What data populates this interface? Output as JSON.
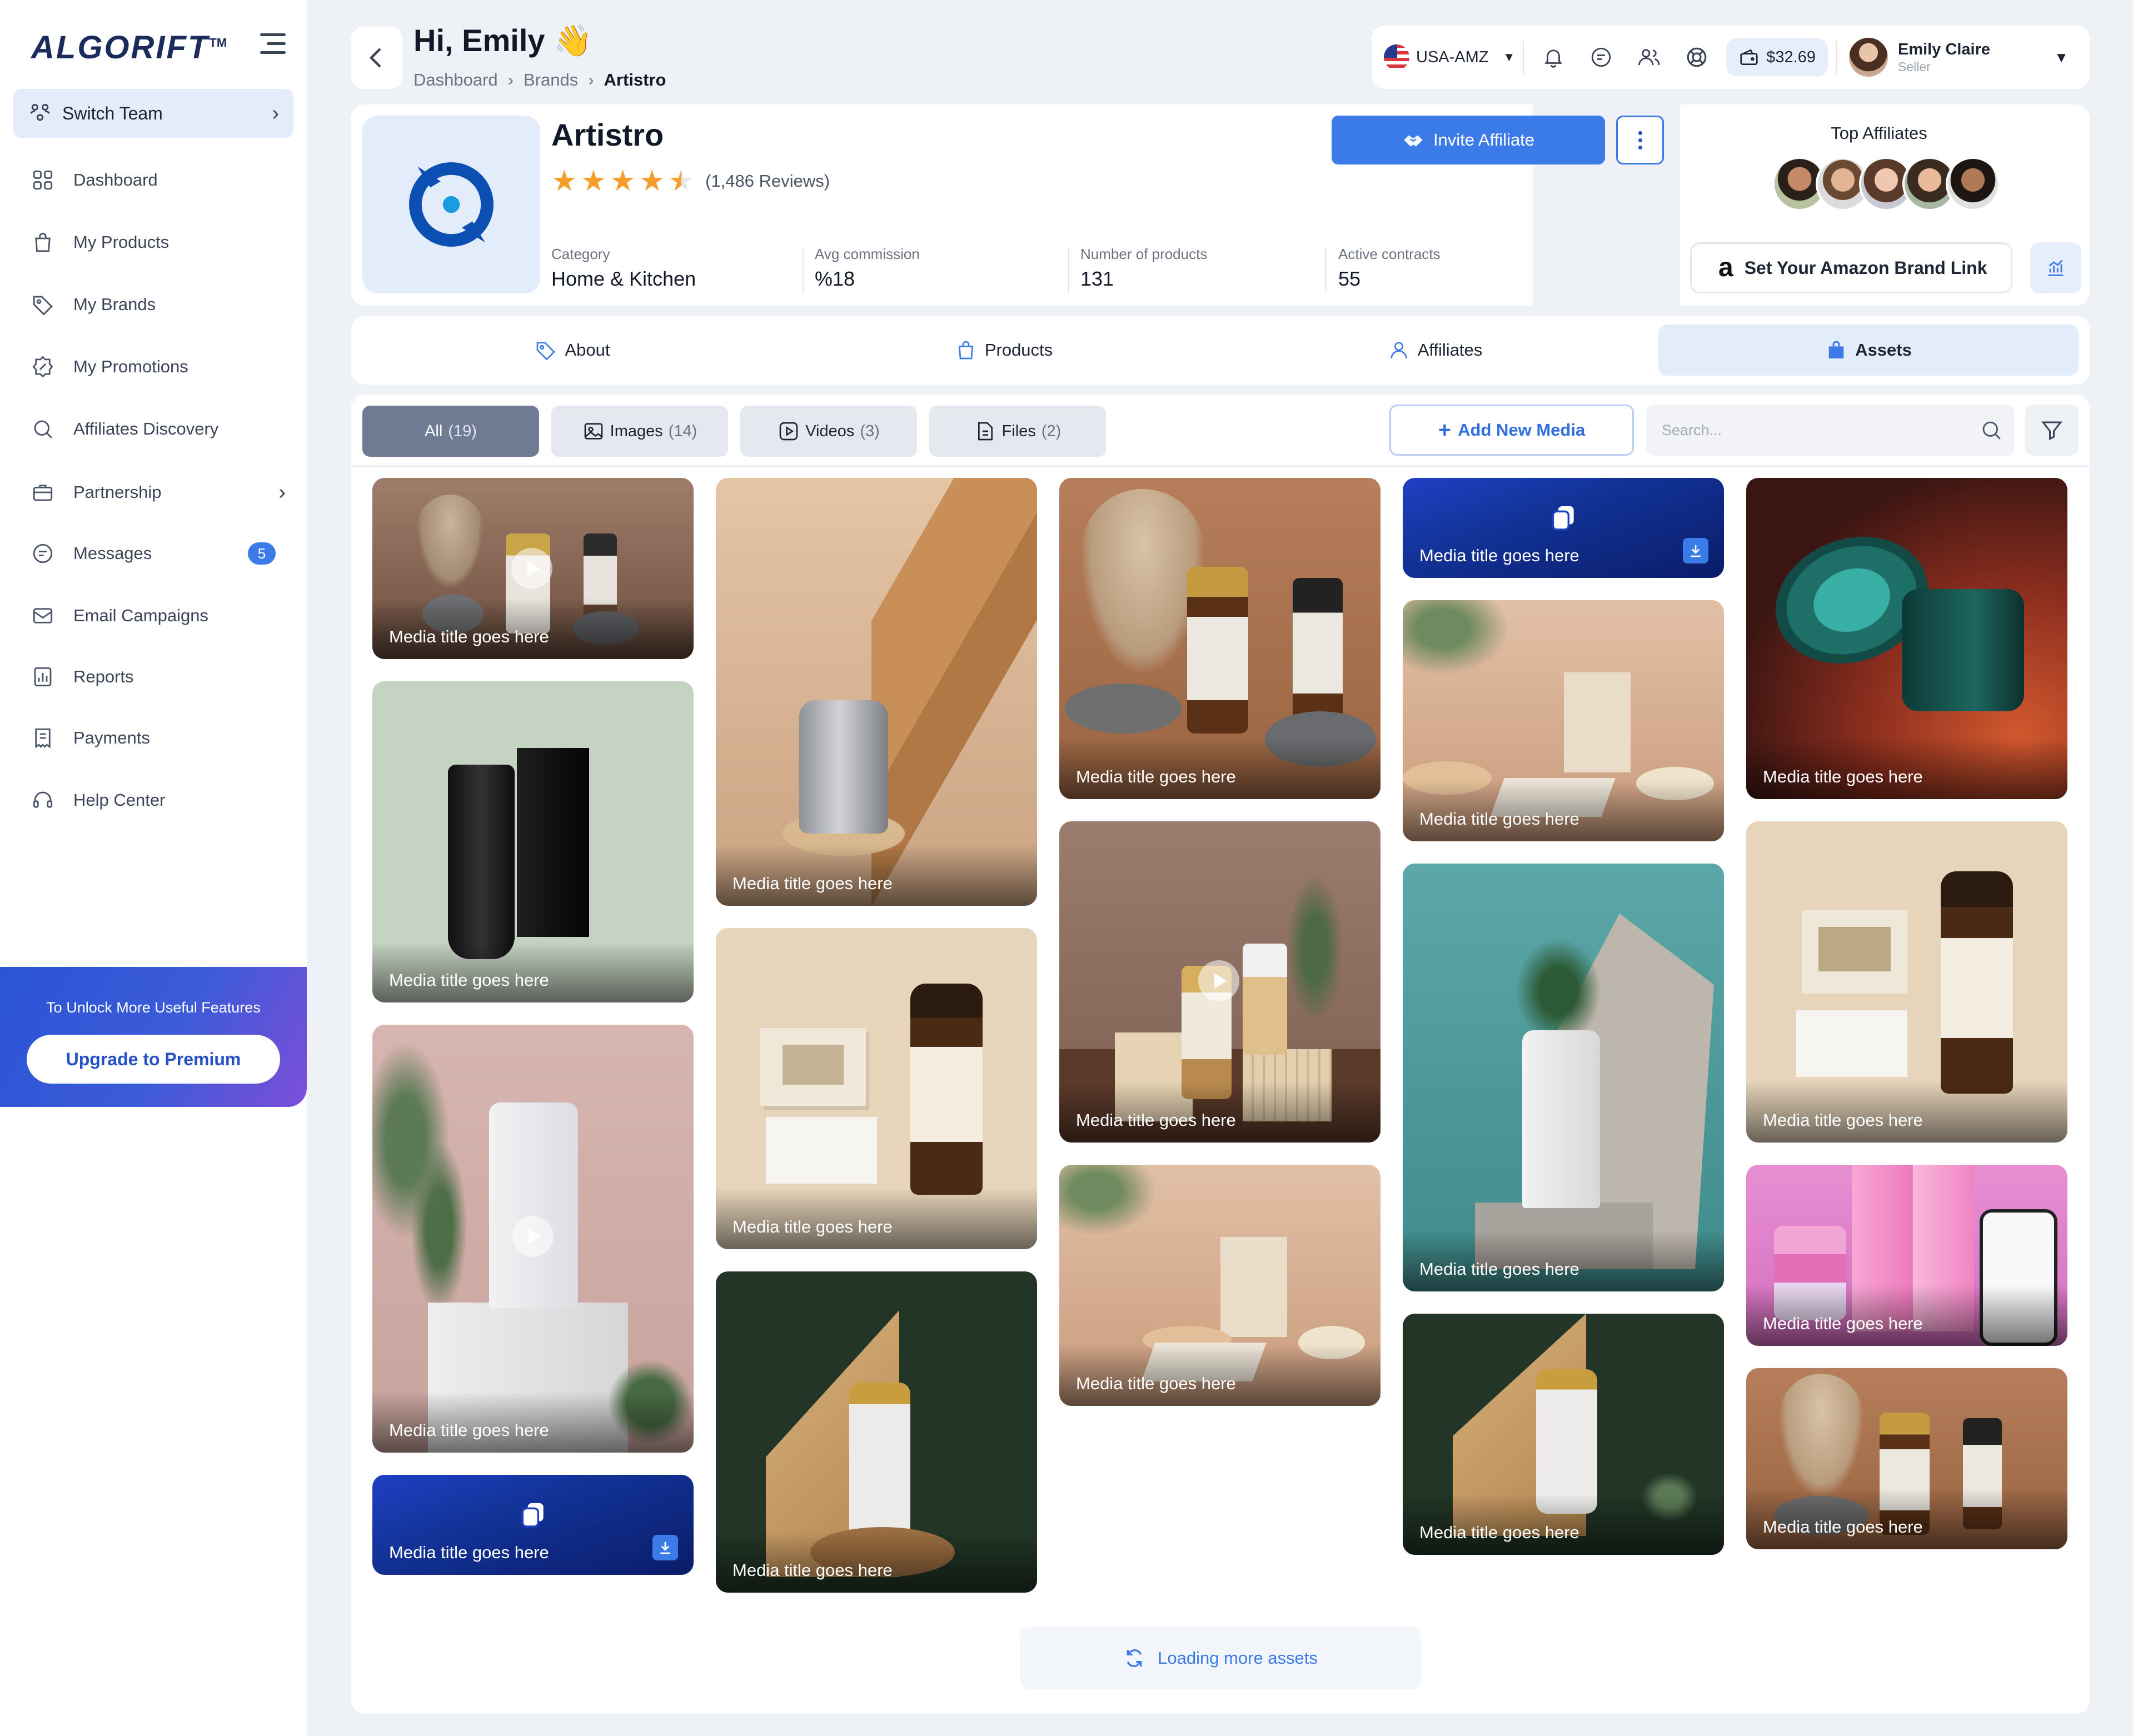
{
  "app": {
    "logo": "ALGORIFT",
    "logo_tm": "TM"
  },
  "sidebar": {
    "switch_team": "Switch Team",
    "items": [
      {
        "label": "Dashboard",
        "icon": "grid-icon"
      },
      {
        "label": "My Products",
        "icon": "shopping-bag-icon"
      },
      {
        "label": "My Brands",
        "icon": "tag-icon"
      },
      {
        "label": "My Promotions",
        "icon": "badge-percent-icon"
      },
      {
        "label": "Affiliates Discovery",
        "icon": "search-icon"
      },
      {
        "label": "Partnership",
        "icon": "briefcase-icon"
      },
      {
        "label": "Messages",
        "icon": "chat-icon",
        "badge": "5"
      },
      {
        "label": "Email Campaigns",
        "icon": "mail-icon"
      },
      {
        "label": "Reports",
        "icon": "bar-chart-icon"
      },
      {
        "label": "Payments",
        "icon": "receipt-icon"
      },
      {
        "label": "Help Center",
        "icon": "headset-icon"
      }
    ],
    "upgrade": {
      "text": "To Unlock More Useful Features",
      "button": "Upgrade to Premium"
    }
  },
  "header": {
    "greeting": "Hi, Emily",
    "wave": "👋",
    "breadcrumb": [
      "Dashboard",
      "Brands",
      "Artistro"
    ],
    "market": "USA-AMZ",
    "wallet": "$32.69",
    "user": {
      "name": "Emily Claire",
      "role": "Seller"
    }
  },
  "brand": {
    "name": "Artistro",
    "rating": 4.5,
    "reviews": "(1,486 Reviews)",
    "stats": [
      {
        "label": "Category",
        "value": "Home & Kitchen"
      },
      {
        "label": "Avg commission",
        "value": "%18"
      },
      {
        "label": "Number of products",
        "value": "131"
      },
      {
        "label": "Active contracts",
        "value": "55"
      }
    ],
    "invite_label": "Invite Affiliate",
    "top_affiliates_title": "Top Affiliates",
    "amazon_link_label": "Set Your Amazon Brand Link"
  },
  "tabs": [
    {
      "label": "About",
      "icon": "tag-icon"
    },
    {
      "label": "Products",
      "icon": "shopping-bag-icon"
    },
    {
      "label": "Affiliates",
      "icon": "user-icon"
    },
    {
      "label": "Assets",
      "icon": "folder-bag-icon",
      "active": true
    }
  ],
  "assets": {
    "filters": [
      {
        "label": "All",
        "count": "(19)",
        "active": true
      },
      {
        "label": "Images",
        "count": "(14)"
      },
      {
        "label": "Videos",
        "count": "(3)"
      },
      {
        "label": "Files",
        "count": "(2)"
      }
    ],
    "add_media": "Add New Media",
    "search_placeholder": "Search...",
    "media_title": "Media title goes here",
    "loading": "Loading more assets"
  },
  "colors": {
    "accent": "#3b7be8",
    "active_chip": "#6f7a93",
    "tab_active_bg": "#e3ecfb",
    "badge": "#3b7be8"
  }
}
